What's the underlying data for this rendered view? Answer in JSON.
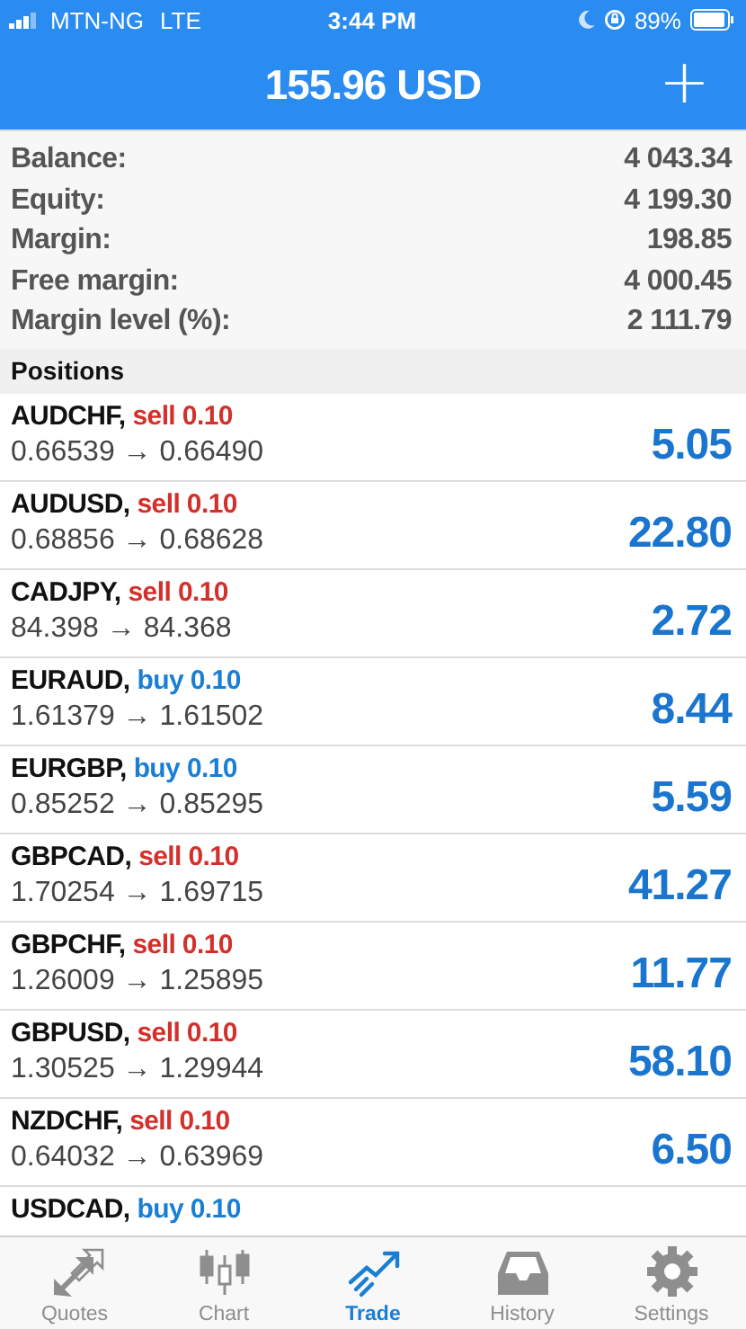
{
  "status_bar": {
    "carrier": "MTN-NG",
    "network": "LTE",
    "time": "3:44 PM",
    "battery": "89%"
  },
  "header": {
    "title": "155.96 USD",
    "add": "+"
  },
  "summary": [
    {
      "label": "Balance:",
      "value": "4 043.34"
    },
    {
      "label": "Equity:",
      "value": "4 199.30"
    },
    {
      "label": "Margin:",
      "value": "198.85"
    },
    {
      "label": "Free margin:",
      "value": "4 000.45"
    },
    {
      "label": "Margin level (%):",
      "value": "2 111.79"
    }
  ],
  "positions": {
    "title": "Positions",
    "rows": [
      {
        "symbol": "AUDCHF,",
        "color": "#d3302b",
        "order": "sell 0.10",
        "prices": "0.66539 → 0.66490",
        "profit": "5.05"
      },
      {
        "symbol": "AUDUSD,",
        "color": "#d3302b",
        "order": "sell 0.10",
        "prices": "0.68856 → 0.68628",
        "profit": "22.80"
      },
      {
        "symbol": "CADJPY,",
        "color": "#d3302b",
        "order": "sell 0.10",
        "prices": "84.398 → 84.368",
        "profit": "2.72"
      },
      {
        "symbol": "EURAUD,",
        "color": "#1a7fd4",
        "order": "buy 0.10",
        "prices": "1.61379 → 1.61502",
        "profit": "8.44"
      },
      {
        "symbol": "EURGBP,",
        "color": "#1a7fd4",
        "order": "buy 0.10",
        "prices": "0.85252 → 0.85295",
        "profit": "5.59"
      },
      {
        "symbol": "GBPCAD,",
        "color": "#d3302b",
        "order": "sell 0.10",
        "prices": "1.70254 → 1.69715",
        "profit": "41.27"
      },
      {
        "symbol": "GBPCHF,",
        "color": "#d3302b",
        "order": "sell 0.10",
        "prices": "1.26009 → 1.25895",
        "profit": "11.77"
      },
      {
        "symbol": "GBPUSD,",
        "color": "#d3302b",
        "order": "sell 0.10",
        "prices": "1.30525 → 1.29944",
        "profit": "58.10"
      },
      {
        "symbol": "NZDCHF,",
        "color": "#d3302b",
        "order": "sell 0.10",
        "prices": "0.64032 → 0.63969",
        "profit": "6.50"
      },
      {
        "symbol": "USDCAD,",
        "color": "#1a7fd4",
        "order": "buy 0.10"
      }
    ]
  },
  "tabs": [
    {
      "label": "Quotes",
      "selected": false
    },
    {
      "label": "Chart",
      "selected": false
    },
    {
      "label": "Trade",
      "selected": true
    },
    {
      "label": "History",
      "selected": false
    },
    {
      "label": "Settings",
      "selected": false
    }
  ]
}
